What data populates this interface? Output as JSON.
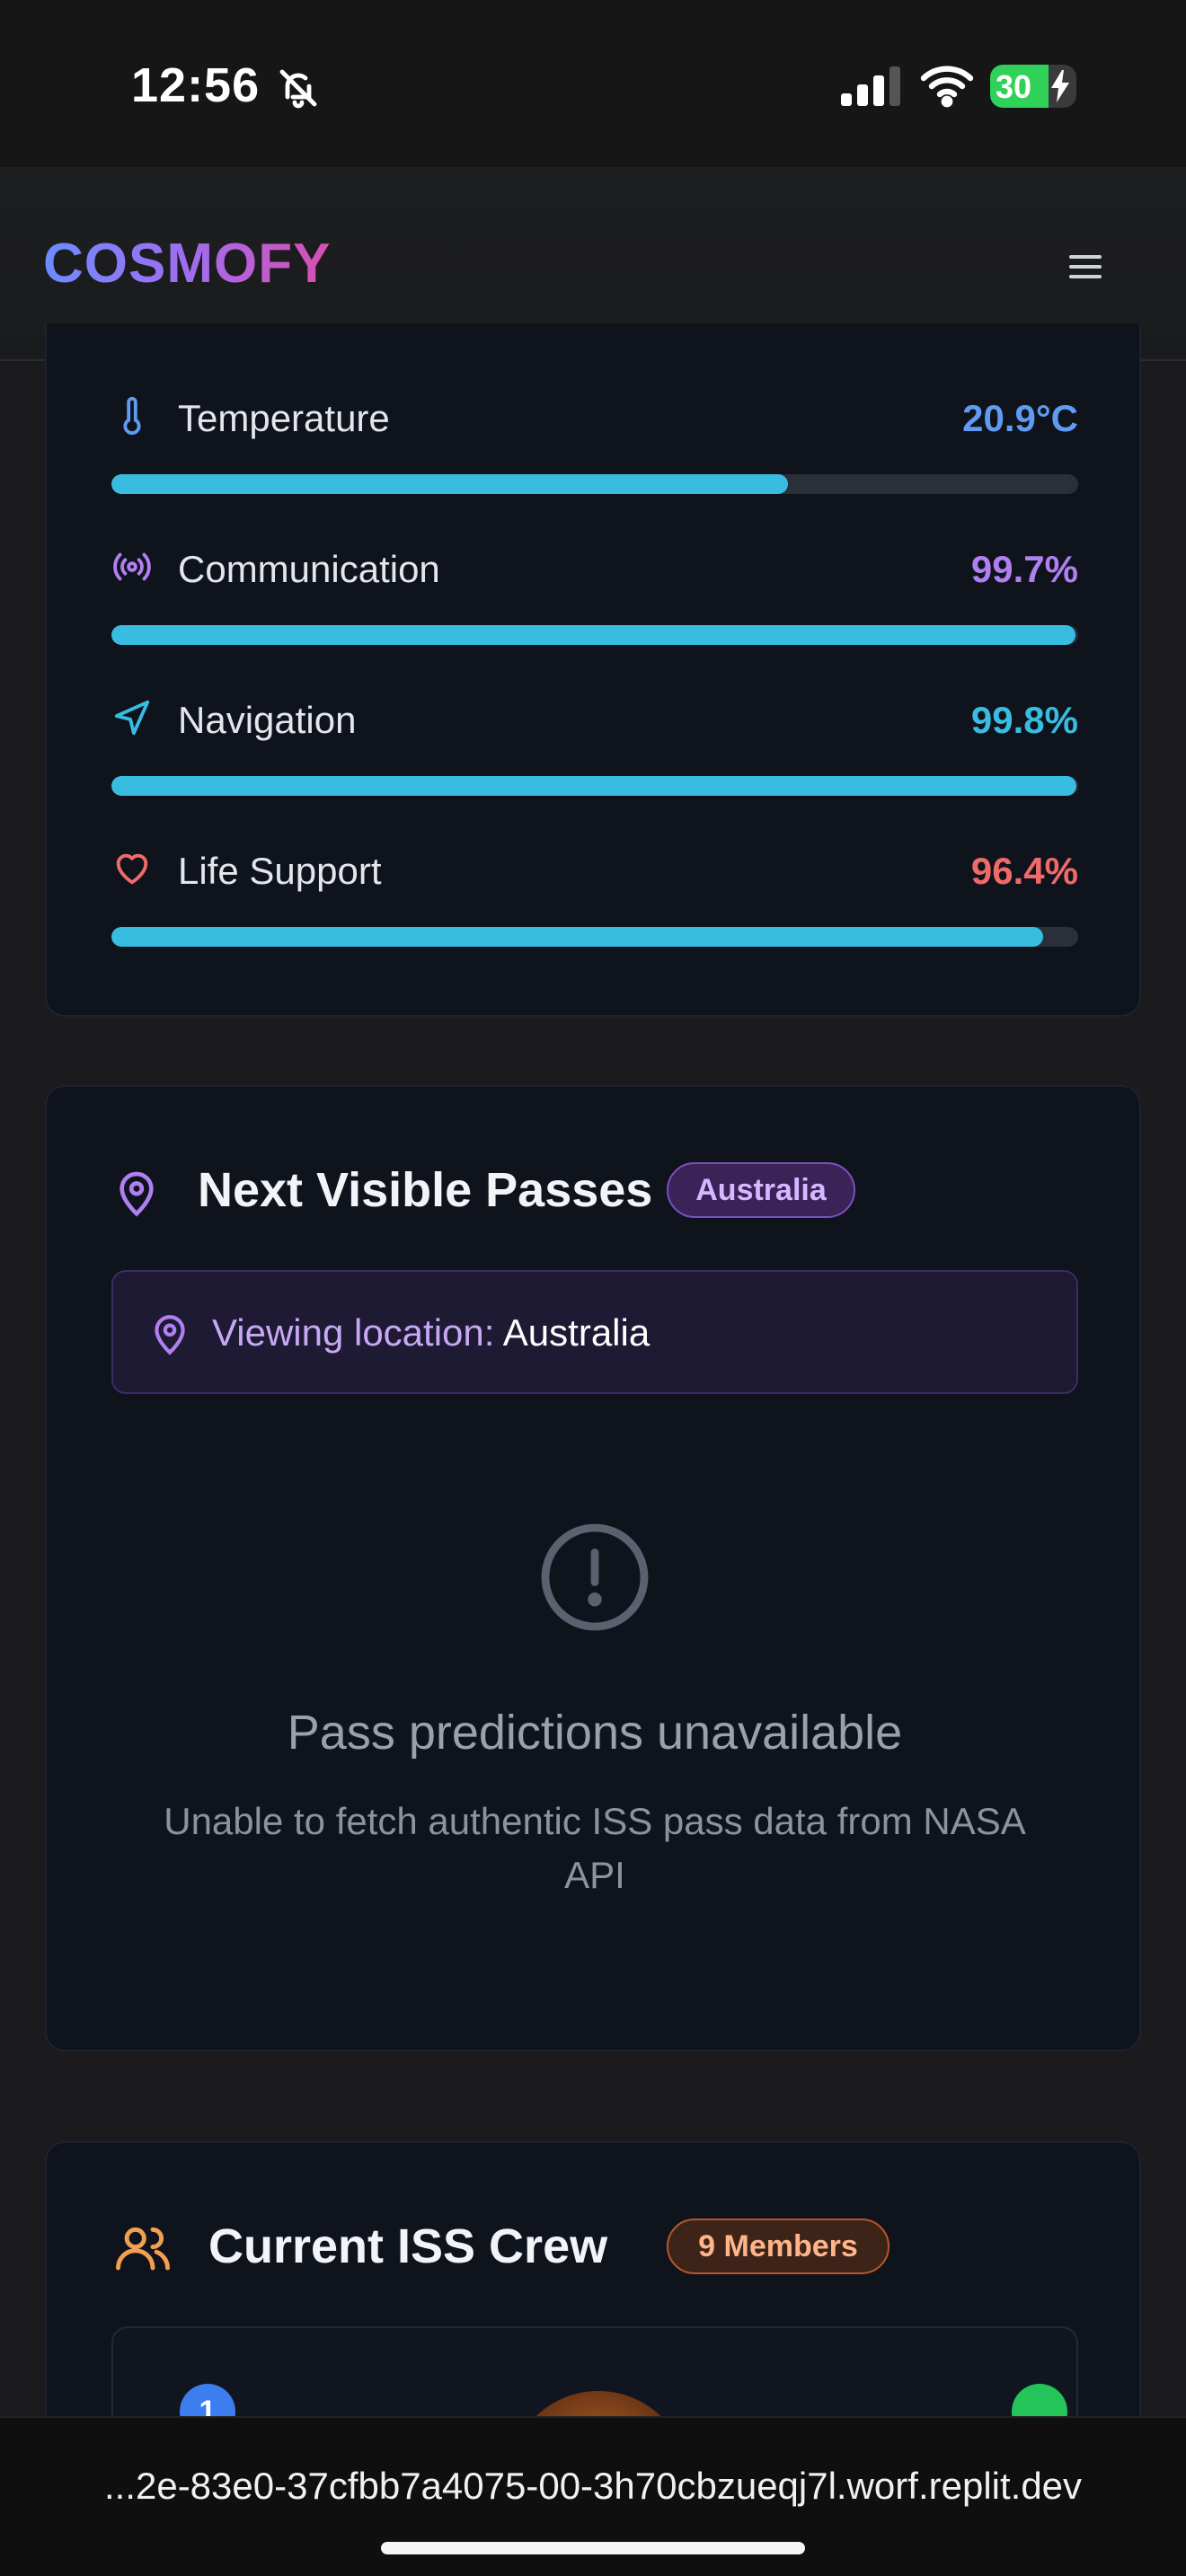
{
  "status_bar": {
    "time": "12:56",
    "battery": "30",
    "battery_level": 0.3
  },
  "header": {
    "logo": "COSMOFY"
  },
  "system_metrics": [
    {
      "label": "Temperature",
      "value": "20.9°C",
      "value_color": "#5f9bf0",
      "progress": 0.7,
      "icon": "thermometer-icon"
    },
    {
      "label": "Communication",
      "value": "99.7%",
      "value_color": "#b07ff0",
      "progress": 0.997,
      "icon": "broadcast-icon"
    },
    {
      "label": "Navigation",
      "value": "99.8%",
      "value_color": "#38bde0",
      "progress": 0.998,
      "icon": "navigation-icon"
    },
    {
      "label": "Life Support",
      "value": "96.4%",
      "value_color": "#f06a6a",
      "progress": 0.964,
      "icon": "heart-icon"
    }
  ],
  "passes": {
    "title": "Next Visible Passes",
    "badge": "Australia",
    "location_label": "Viewing location:",
    "location_value": "Australia",
    "error_title": "Pass predictions unavailable",
    "error_desc": "Unable to fetch authentic ISS pass data from NASA API"
  },
  "crew": {
    "title": "Current ISS Crew",
    "badge": "9 Members",
    "first_rank": "1"
  },
  "browser": {
    "url": "...2e-83e0-37cfbb7a4075-00-3h70cbzueqj7l.worf.replit.dev"
  },
  "colors": {
    "accent_cyan": "#38bde0",
    "purple": "#a070e8",
    "orange": "#f0a050"
  }
}
